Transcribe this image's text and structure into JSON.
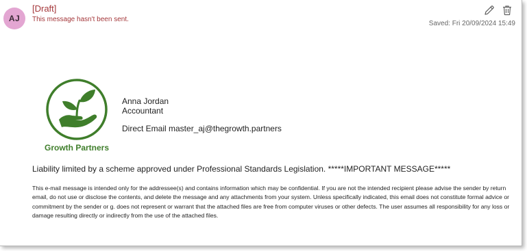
{
  "header": {
    "avatar_initials": "AJ",
    "avatar_color": "#e3a6d2",
    "draft_label": "[Draft]",
    "draft_note": "This message hasn't been sent.",
    "draft_color": "#a4373a",
    "saved_text": "Saved: Fri 20/09/2024 15:49",
    "actions": [
      {
        "name": "edit",
        "icon": "pencil-icon"
      },
      {
        "name": "delete",
        "icon": "trash-icon"
      }
    ]
  },
  "signature": {
    "logo_icon": "plant-in-hand-icon",
    "logo_color": "#3f7e2b",
    "company": "Growth Partners",
    "name": "Anna Jordan",
    "title": "Accountant",
    "email_line": "Direct Email master_aj@thegrowth.partners"
  },
  "body": {
    "liability": "Liability limited by a scheme approved under Professional Standards Legislation. *****IMPORTANT MESSAGE*****",
    "disclaimer": "This e-mail message is intended only for the addressee(s) and contains information which may be confidential. If you are not the intended recipient please advise the sender by return email, do not use or disclose the contents, and delete the message and any attachments from your system. Unless specifically indicated, this email does not constitute formal advice or commitment by the sender or g. does not represent or warrant that the attached files are free from computer viruses or other defects. The user assumes all responsibility for any loss or damage resulting directly or indirectly from the use of the attached files."
  }
}
